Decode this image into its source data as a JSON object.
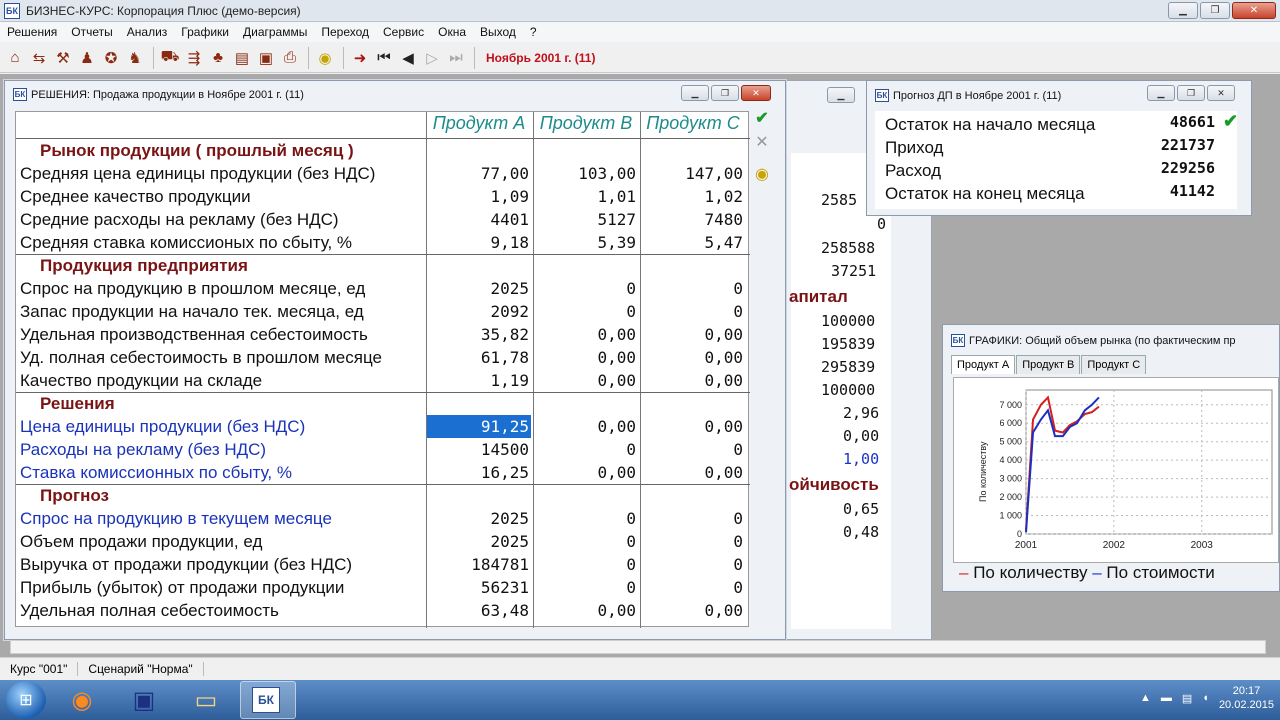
{
  "app": {
    "title": "БИЗНЕС-КУРС: Корпорация Плюс (демо-версия)",
    "icon_text": "БК"
  },
  "menu": [
    "Решения",
    "Отчеты",
    "Анализ",
    "Графики",
    "Диаграммы",
    "Переход",
    "Сервис",
    "Окна",
    "Выход",
    "?"
  ],
  "toolbar": {
    "date": "Ноябрь 2001 г. (11)"
  },
  "decisions": {
    "title": "РЕШЕНИЯ: Продажа продукции в  Ноябре 2001 г. (11)",
    "columns": [
      "Продукт A",
      "Продукт B",
      "Продукт C"
    ],
    "rows": [
      {
        "label": "Рынок продукции ( прошлый месяц )",
        "type": "sec",
        "vals": [
          "",
          "",
          ""
        ]
      },
      {
        "label": "Средняя цена единицы продукции (без НДС)",
        "type": "",
        "vals": [
          "77,00",
          "103,00",
          "147,00"
        ]
      },
      {
        "label": "Среднее качество продукции",
        "type": "",
        "vals": [
          "1,09",
          "1,01",
          "1,02"
        ]
      },
      {
        "label": "Средние расходы на рекламу (без НДС)",
        "type": "",
        "vals": [
          "4401",
          "5127",
          "7480"
        ]
      },
      {
        "label": "Средняя ставка комиссионых по сбыту, %",
        "type": "",
        "vals": [
          "9,18",
          "5,39",
          "5,47"
        ]
      },
      {
        "label": "Продукция предприятия",
        "type": "sec",
        "vals": [
          "",
          "",
          ""
        ]
      },
      {
        "label": "Спрос на продукцию в прошлом месяце, ед",
        "type": "",
        "vals": [
          "2025",
          "0",
          "0"
        ]
      },
      {
        "label": "Запас продукции на начало тек. месяца, ед",
        "type": "",
        "vals": [
          "2092",
          "0",
          "0"
        ]
      },
      {
        "label": "Удельная  производственная себестоимость",
        "type": "",
        "vals": [
          "35,82",
          "0,00",
          "0,00"
        ]
      },
      {
        "label": "Уд. полная себестоимость в прошлом месяце",
        "type": "",
        "vals": [
          "61,78",
          "0,00",
          "0,00"
        ]
      },
      {
        "label": "Качество продукции на складе",
        "type": "",
        "vals": [
          "1,19",
          "0,00",
          "0,00"
        ]
      },
      {
        "label": "Решения",
        "type": "sec",
        "vals": [
          "",
          "",
          ""
        ]
      },
      {
        "label": "Цена единицы продукции (без НДС)",
        "type": "blue",
        "vals": [
          "91,25",
          "0,00",
          "0,00"
        ]
      },
      {
        "label": "Расходы на рекламу (без НДС)",
        "type": "blue",
        "vals": [
          "14500",
          "0",
          "0"
        ]
      },
      {
        "label": "Ставка комиссионных по сбыту, %",
        "type": "blue",
        "vals": [
          "16,25",
          "0,00",
          "0,00"
        ]
      },
      {
        "label": "Прогноз",
        "type": "sec",
        "vals": [
          "",
          "",
          ""
        ]
      },
      {
        "label": "Спрос на продукцию в текущем месяце",
        "type": "blue",
        "vals": [
          "2025",
          "0",
          "0"
        ]
      },
      {
        "label": "Объем продажи продукции, ед",
        "type": "",
        "vals": [
          "2025",
          "0",
          "0"
        ]
      },
      {
        "label": "Выручка от продажи продукции (без НДС)",
        "type": "",
        "vals": [
          "184781",
          "0",
          "0"
        ]
      },
      {
        "label": "Прибыль (убыток) от продажи продукции",
        "type": "",
        "vals": [
          "56231",
          "0",
          "0"
        ]
      },
      {
        "label": "Удельная полная себестоимость",
        "type": "",
        "vals": [
          "63,48",
          "0,00",
          "0,00"
        ]
      }
    ]
  },
  "background_window": {
    "headings": [
      "апитал",
      "ойчивость"
    ],
    "values": [
      "2585",
      "0",
      "258588",
      "37251",
      "100000",
      "195839",
      "295839",
      "100000",
      "2,96",
      "0,00",
      "1,00",
      "0,65",
      "0,48"
    ]
  },
  "forecast": {
    "title": "Прогноз ДП в Ноябре 2001 г. (11)",
    "rows": [
      {
        "k": "Остаток на начало месяца",
        "n": "48661"
      },
      {
        "k": "Приход",
        "n": "221737"
      },
      {
        "k": "Расход",
        "n": "229256"
      },
      {
        "k": "Остаток на конец месяца",
        "n": "41142"
      }
    ]
  },
  "graphs": {
    "title": "ГРАФИКИ: Общий объем рынка (по фактическим пр",
    "tabs": [
      "Продукт A",
      "Продукт B",
      "Продукт C"
    ],
    "legend_qty": "По количеству",
    "legend_cost": "По стоимости"
  },
  "chart_data": {
    "type": "line",
    "ylabel": "По количеству",
    "ylim": [
      0,
      7800
    ],
    "yticks": [
      "0",
      "1 000",
      "2 000",
      "3 000",
      "4 000",
      "5 000",
      "6 000",
      "7 000"
    ],
    "xticks": [
      "2001",
      "2002",
      "2003"
    ],
    "x": [
      2001.0,
      2001.08,
      2001.17,
      2001.25,
      2001.33,
      2001.42,
      2001.5,
      2001.58,
      2001.67,
      2001.75,
      2001.83
    ],
    "series": [
      {
        "name": "По количеству",
        "color": "#d42020",
        "values": [
          200,
          6200,
          7000,
          7400,
          5600,
          5500,
          5900,
          6100,
          6500,
          6600,
          6900
        ]
      },
      {
        "name": "По стоимости",
        "color": "#1c2fc0",
        "values": [
          100,
          5500,
          6200,
          6700,
          5300,
          5300,
          5800,
          6000,
          6700,
          7000,
          7400
        ]
      }
    ]
  },
  "status": {
    "course": "Курс \"001\"",
    "scenario": "Сценарий \"Норма\""
  },
  "taskbar": {
    "time": "20:17",
    "date": "20.02.2015",
    "active_text": "БК"
  },
  "colors": {
    "section": "#7a1414",
    "decision": "#1a33b8",
    "header": "#1d8b8b",
    "date": "#c0101a",
    "selection": "#1a6fd1"
  }
}
